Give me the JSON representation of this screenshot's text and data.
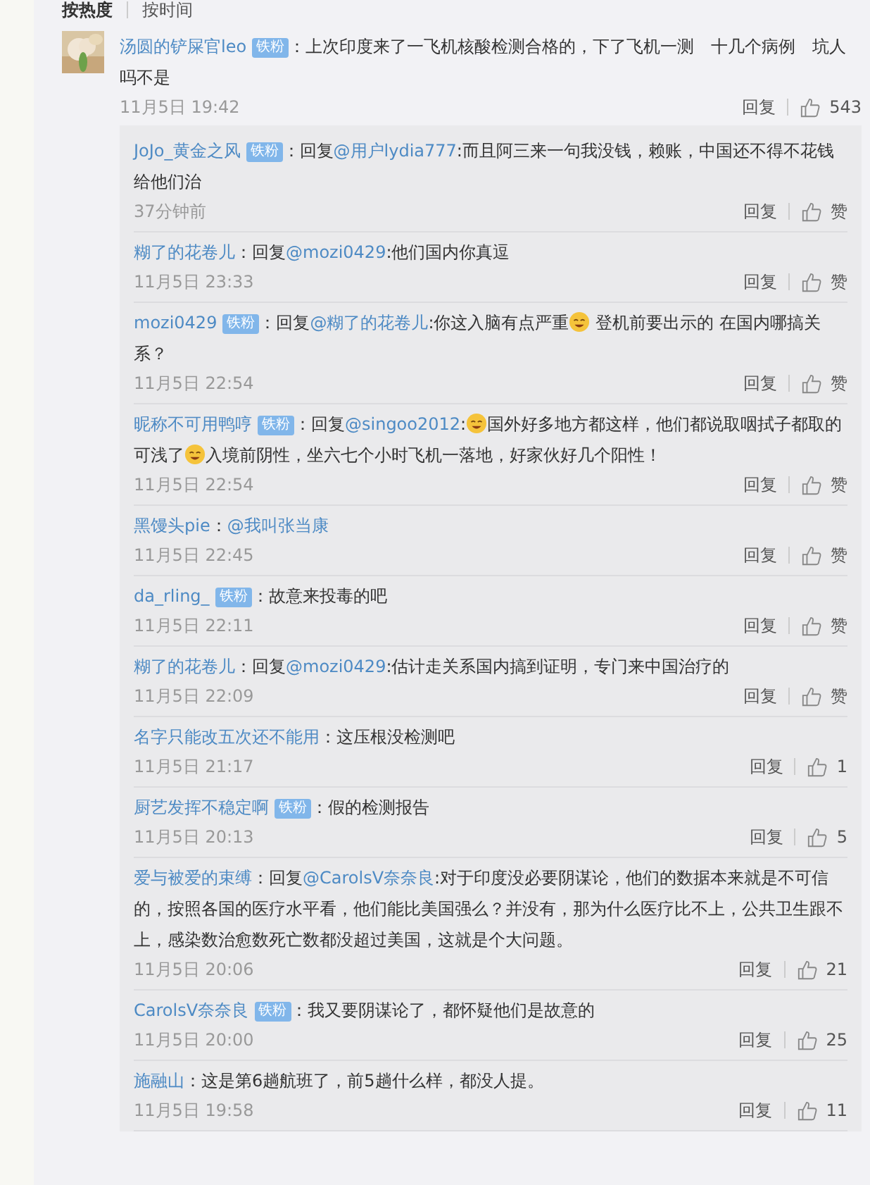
{
  "sort_tabs": [
    {
      "label": "按热度",
      "selected": true
    },
    {
      "label": "按时间",
      "selected": false
    }
  ],
  "comment": {
    "user": "汤圆的铲屎官leo",
    "badge": "铁粉",
    "parts": [
      {
        "kind": "plain",
        "text": "：上次印度来了一飞机核酸检测合格的，下了飞机一测　十几个病例　坑人吗不是"
      }
    ],
    "time": "11月5日 19:42",
    "reply": "回复",
    "likes": "543"
  },
  "replies": [
    {
      "user": "JoJo_黄金之风",
      "badge": "铁粉",
      "parts": [
        {
          "kind": "plain",
          "text": "：回复"
        },
        {
          "kind": "mention",
          "text": "@用户lydia777"
        },
        {
          "kind": "plain",
          "text": ":而且阿三来一句我没钱，赖账，中国还不得不花钱给他们治"
        }
      ],
      "time": "37分钟前",
      "reply": "回复",
      "likes": "赞"
    },
    {
      "user": "糊了的花卷儿",
      "parts": [
        {
          "kind": "plain",
          "text": "：回复"
        },
        {
          "kind": "mention",
          "text": "@mozi0429"
        },
        {
          "kind": "plain",
          "text": ":他们国内你真逗"
        }
      ],
      "time": "11月5日 23:33",
      "reply": "回复",
      "likes": "赞"
    },
    {
      "user": "mozi0429",
      "badge": "铁粉",
      "parts": [
        {
          "kind": "plain",
          "text": "：回复"
        },
        {
          "kind": "mention",
          "text": "@糊了的花卷儿"
        },
        {
          "kind": "plain",
          "text": ":你这入脑有点严重"
        },
        {
          "kind": "emoji"
        },
        {
          "kind": "plain",
          "text": " 登机前要出示的 在国内哪搞关系？"
        }
      ],
      "time": "11月5日 22:54",
      "reply": "回复",
      "likes": "赞"
    },
    {
      "user": "昵称不可用鸭哼",
      "badge": "铁粉",
      "parts": [
        {
          "kind": "plain",
          "text": "：回复"
        },
        {
          "kind": "mention",
          "text": "@singoo2012"
        },
        {
          "kind": "plain",
          "text": ":"
        },
        {
          "kind": "emoji"
        },
        {
          "kind": "plain",
          "text": "国外好多地方都这样，他们都说取咽拭子都取的可浅了"
        },
        {
          "kind": "emoji"
        },
        {
          "kind": "plain",
          "text": "入境前阴性，坐六七个小时飞机一落地，好家伙好几个阳性！"
        }
      ],
      "time": "11月5日 22:54",
      "reply": "回复",
      "likes": "赞"
    },
    {
      "user": "黑馒头pie",
      "parts": [
        {
          "kind": "plain",
          "text": "："
        },
        {
          "kind": "mention",
          "text": "@我叫张当康"
        }
      ],
      "time": "11月5日 22:45",
      "reply": "回复",
      "likes": "赞"
    },
    {
      "user": "da_rling_",
      "badge": "铁粉",
      "parts": [
        {
          "kind": "plain",
          "text": "：故意来投毒的吧"
        }
      ],
      "time": "11月5日 22:11",
      "reply": "回复",
      "likes": "赞"
    },
    {
      "user": "糊了的花卷儿",
      "parts": [
        {
          "kind": "plain",
          "text": "：回复"
        },
        {
          "kind": "mention",
          "text": "@mozi0429"
        },
        {
          "kind": "plain",
          "text": ":估计走关系国内搞到证明，专门来中国治疗的"
        }
      ],
      "time": "11月5日 22:09",
      "reply": "回复",
      "likes": "赞"
    },
    {
      "user": "名字只能改五次还不能用",
      "parts": [
        {
          "kind": "plain",
          "text": "：这压根没检测吧"
        }
      ],
      "time": "11月5日 21:17",
      "reply": "回复",
      "likes": "1"
    },
    {
      "user": "厨艺发挥不稳定啊",
      "badge": "铁粉",
      "parts": [
        {
          "kind": "plain",
          "text": "：假的检测报告"
        }
      ],
      "time": "11月5日 20:13",
      "reply": "回复",
      "likes": "5"
    },
    {
      "user": "爱与被爱的束缚",
      "parts": [
        {
          "kind": "plain",
          "text": "：回复"
        },
        {
          "kind": "mention",
          "text": "@CarolsV奈奈良"
        },
        {
          "kind": "plain",
          "text": ":对于印度没必要阴谋论，他们的数据本来就是不可信的，按照各国的医疗水平看，他们能比美国强么？并没有，那为什么医疗比不上，公共卫生跟不上，感染数治愈数死亡数都没超过美国，这就是个大问题。"
        }
      ],
      "time": "11月5日 20:06",
      "reply": "回复",
      "likes": "21"
    },
    {
      "user": "CarolsV奈奈良",
      "badge": "铁粉",
      "parts": [
        {
          "kind": "plain",
          "text": "：我又要阴谋论了，都怀疑他们是故意的"
        }
      ],
      "time": "11月5日 20:00",
      "reply": "回复",
      "likes": "25"
    },
    {
      "user": "施融山",
      "parts": [
        {
          "kind": "plain",
          "text": "：这是第6趟航班了，前5趟什么样，都没人提。"
        }
      ],
      "time": "11月5日 19:58",
      "reply": "回复",
      "likes": "11"
    }
  ]
}
